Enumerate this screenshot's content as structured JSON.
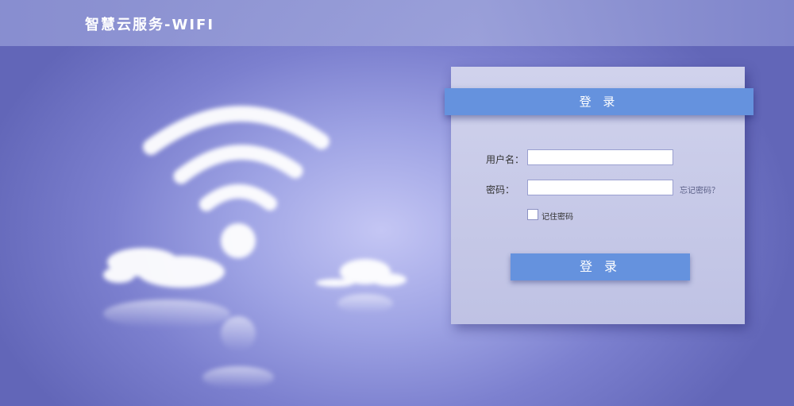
{
  "header": {
    "brand": "智慧云服务-WIFI"
  },
  "login": {
    "title": "登 录",
    "username_label": "用户名：",
    "username_value": "",
    "password_label": "密码：",
    "password_value": "",
    "forgot_link": "忘记密码？",
    "remember_label": "记住密码",
    "submit_label": "登 录"
  },
  "colors": {
    "accent": "#6592de",
    "background": "#8a8fd8",
    "panel": "#c8cbe9"
  }
}
